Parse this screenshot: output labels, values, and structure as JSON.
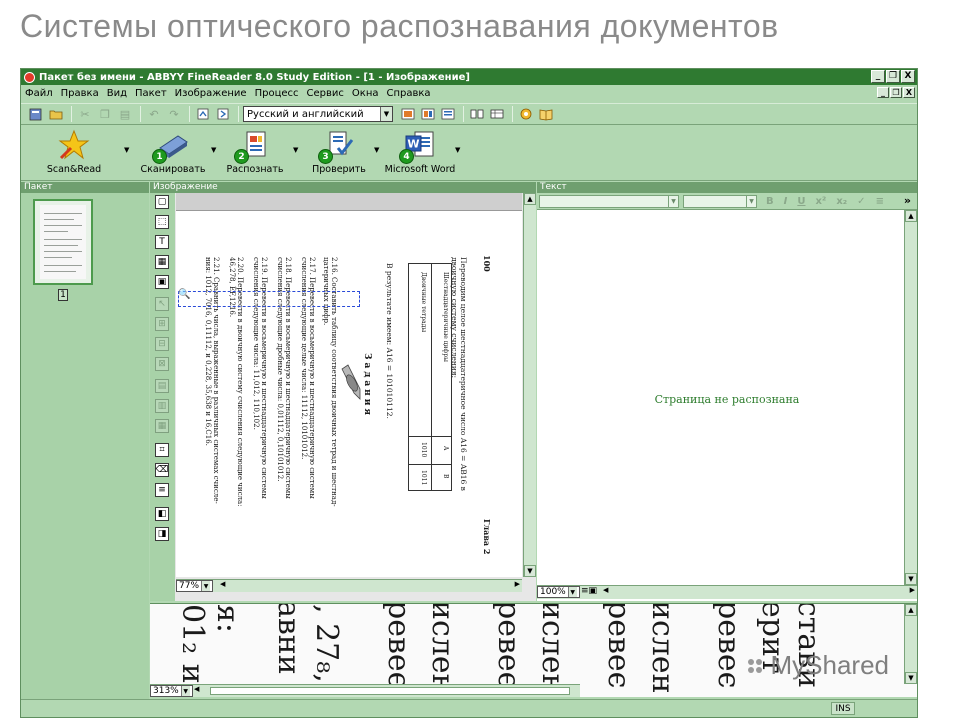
{
  "slide_title": "Системы оптического распознавания документов",
  "window": {
    "title": "Пакет без имени - ABBYY FineReader 8.0 Study Edition - [1 - Изображение]",
    "buttons": [
      "_",
      "❐",
      "X"
    ]
  },
  "menu": [
    "Файл",
    "Правка",
    "Вид",
    "Пакет",
    "Изображение",
    "Процесс",
    "Сервис",
    "Окна",
    "Справка"
  ],
  "toolbar": {
    "language": "Русский и английский"
  },
  "main_toolbar": [
    {
      "label": "Scan&Read",
      "icon": "star-icon"
    },
    {
      "label": "Сканировать",
      "step": "1",
      "icon": "scanner-icon"
    },
    {
      "label": "Распознать",
      "step": "2",
      "icon": "recognize-icon"
    },
    {
      "label": "Проверить",
      "step": "3",
      "icon": "check-icon"
    },
    {
      "label": "Microsoft Word",
      "step": "4",
      "icon": "word-icon"
    }
  ],
  "panes": {
    "batch": "Пакет",
    "image": "Изображение",
    "text": "Текст"
  },
  "batch": {
    "page_number": "1"
  },
  "image": {
    "zoom": "77%"
  },
  "text_pane": {
    "message": "Страница не распознана",
    "zoom": "100%"
  },
  "zoom_pane": {
    "zoom": "313%"
  },
  "document_text": {
    "page_number": "100",
    "chapter": "Глава 2",
    "lines": [
      "Переводим целое шестнадцатеричное число A16 = AB16 в",
      "двоичную систему счисления:",
      "В результате имеем: A16 = 101010112.",
      "Задания",
      "2.16. Составить таблицу соответствия двоичных тетрад и шестнад-",
      "цатеричных цифр.",
      "2.17. Перевести в восьмеричную и шестнадцатеричную системы",
      "счисления следующие целые числа: 11112, 10101012.",
      "2.18. Перевести в восьмеричную и шестнадцатеричную системы",
      "счисления следующие дробные числа: 0,01112, 0,10101012.",
      "2.19. Перевести в восьмеричную и шестнадцатеричную системы",
      "счисления следующие числа: 11,012, 110,102.",
      "2.20. Перевести в двоичную систему счисления следующие числа:",
      "46,278, EF,1216.",
      "2.21. Сравнить числа, выраженные в различных системах счисле-",
      "ния: 1012, 7016, 0,11112, и 0,228, 35,638 и 16,C16."
    ],
    "table_headers": [
      "Шестнадцатеричные цифры",
      "Двоичные тетрады"
    ],
    "table_cols": [
      "A",
      "B"
    ],
    "table_values": [
      "1010",
      "1011"
    ]
  },
  "zoom_fragments": [
    "01₂ и",
    "я:",
    "авни",
    ", 27₈,",
    "ревеє",
    "ислен",
    "ревеє",
    "ислен",
    "ревеє",
    "ислен",
    "ревеє",
    "ерит",
    "стави"
  ],
  "watermark": "MyShared",
  "status": {
    "ins": "INS"
  },
  "colors": {
    "title_bar": "#2f7a31",
    "chrome": "#b2d8b2",
    "recognized_text": "#2e7d2e",
    "slide_title": "#8a8a8a"
  }
}
